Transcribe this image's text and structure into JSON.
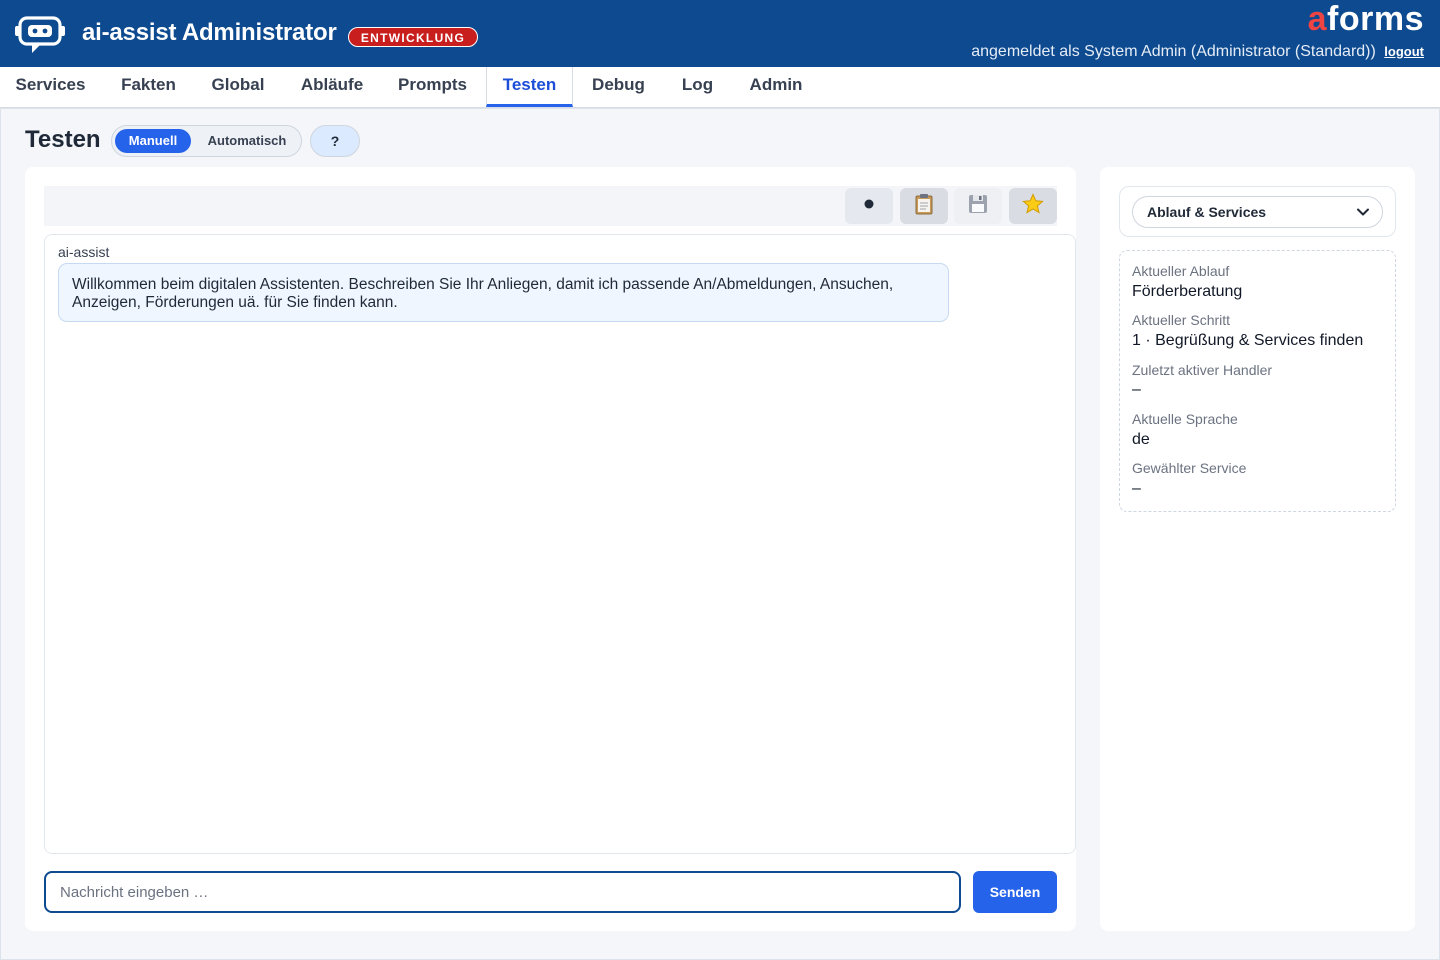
{
  "header": {
    "app_title": "ai-assist Administrator",
    "env_badge": "ENTWICKLUNG",
    "brand_a": "a",
    "brand_rest": "forms",
    "user_info": "angemeldet als System Admin (Administrator (Standard))",
    "logout_label": "logout",
    "colors": {
      "header_bg": "#0d4a8f",
      "badge": "#c81e1e",
      "brand_accent": "#ef4444"
    }
  },
  "nav": {
    "items": [
      {
        "label": "Services"
      },
      {
        "label": "Fakten"
      },
      {
        "label": "Global"
      },
      {
        "label": "Abläufe"
      },
      {
        "label": "Prompts"
      },
      {
        "label": "Testen",
        "active": true
      },
      {
        "label": "Debug"
      },
      {
        "label": "Log"
      },
      {
        "label": "Admin"
      }
    ]
  },
  "page": {
    "title": "Testen",
    "mode_toggle": {
      "options": [
        "Manuell",
        "Automatisch"
      ],
      "selected": "Manuell"
    },
    "help_label": "?"
  },
  "toolbar": {
    "buttons": [
      {
        "icon": "record-dot-icon"
      },
      {
        "icon": "clipboard-icon"
      },
      {
        "icon": "floppy-disk-icon"
      },
      {
        "icon": "star-icon"
      }
    ]
  },
  "chat": {
    "messages": [
      {
        "sender": "ai-assist",
        "text": "Willkommen beim digitalen Assistenten. Beschreiben Sie Ihr Anliegen, damit ich passende An/Abmeldungen, Ansuchen, Anzeigen, Förderungen uä. für Sie finden kann."
      }
    ],
    "input_placeholder": "Nachricht eingeben …",
    "input_value": "",
    "send_label": "Senden"
  },
  "side": {
    "select": {
      "selected": "Ablauf & Services"
    },
    "status": [
      {
        "label": "Aktueller Ablauf",
        "value": "Förderberatung"
      },
      {
        "label": "Aktueller Schritt",
        "value": "1 · Begrüßung & Services finden"
      },
      {
        "label": "Zuletzt aktiver Handler",
        "value": "–"
      },
      {
        "label": "Aktuelle Sprache",
        "value": "de"
      },
      {
        "label": "Gewählter Service",
        "value": "–"
      }
    ]
  }
}
